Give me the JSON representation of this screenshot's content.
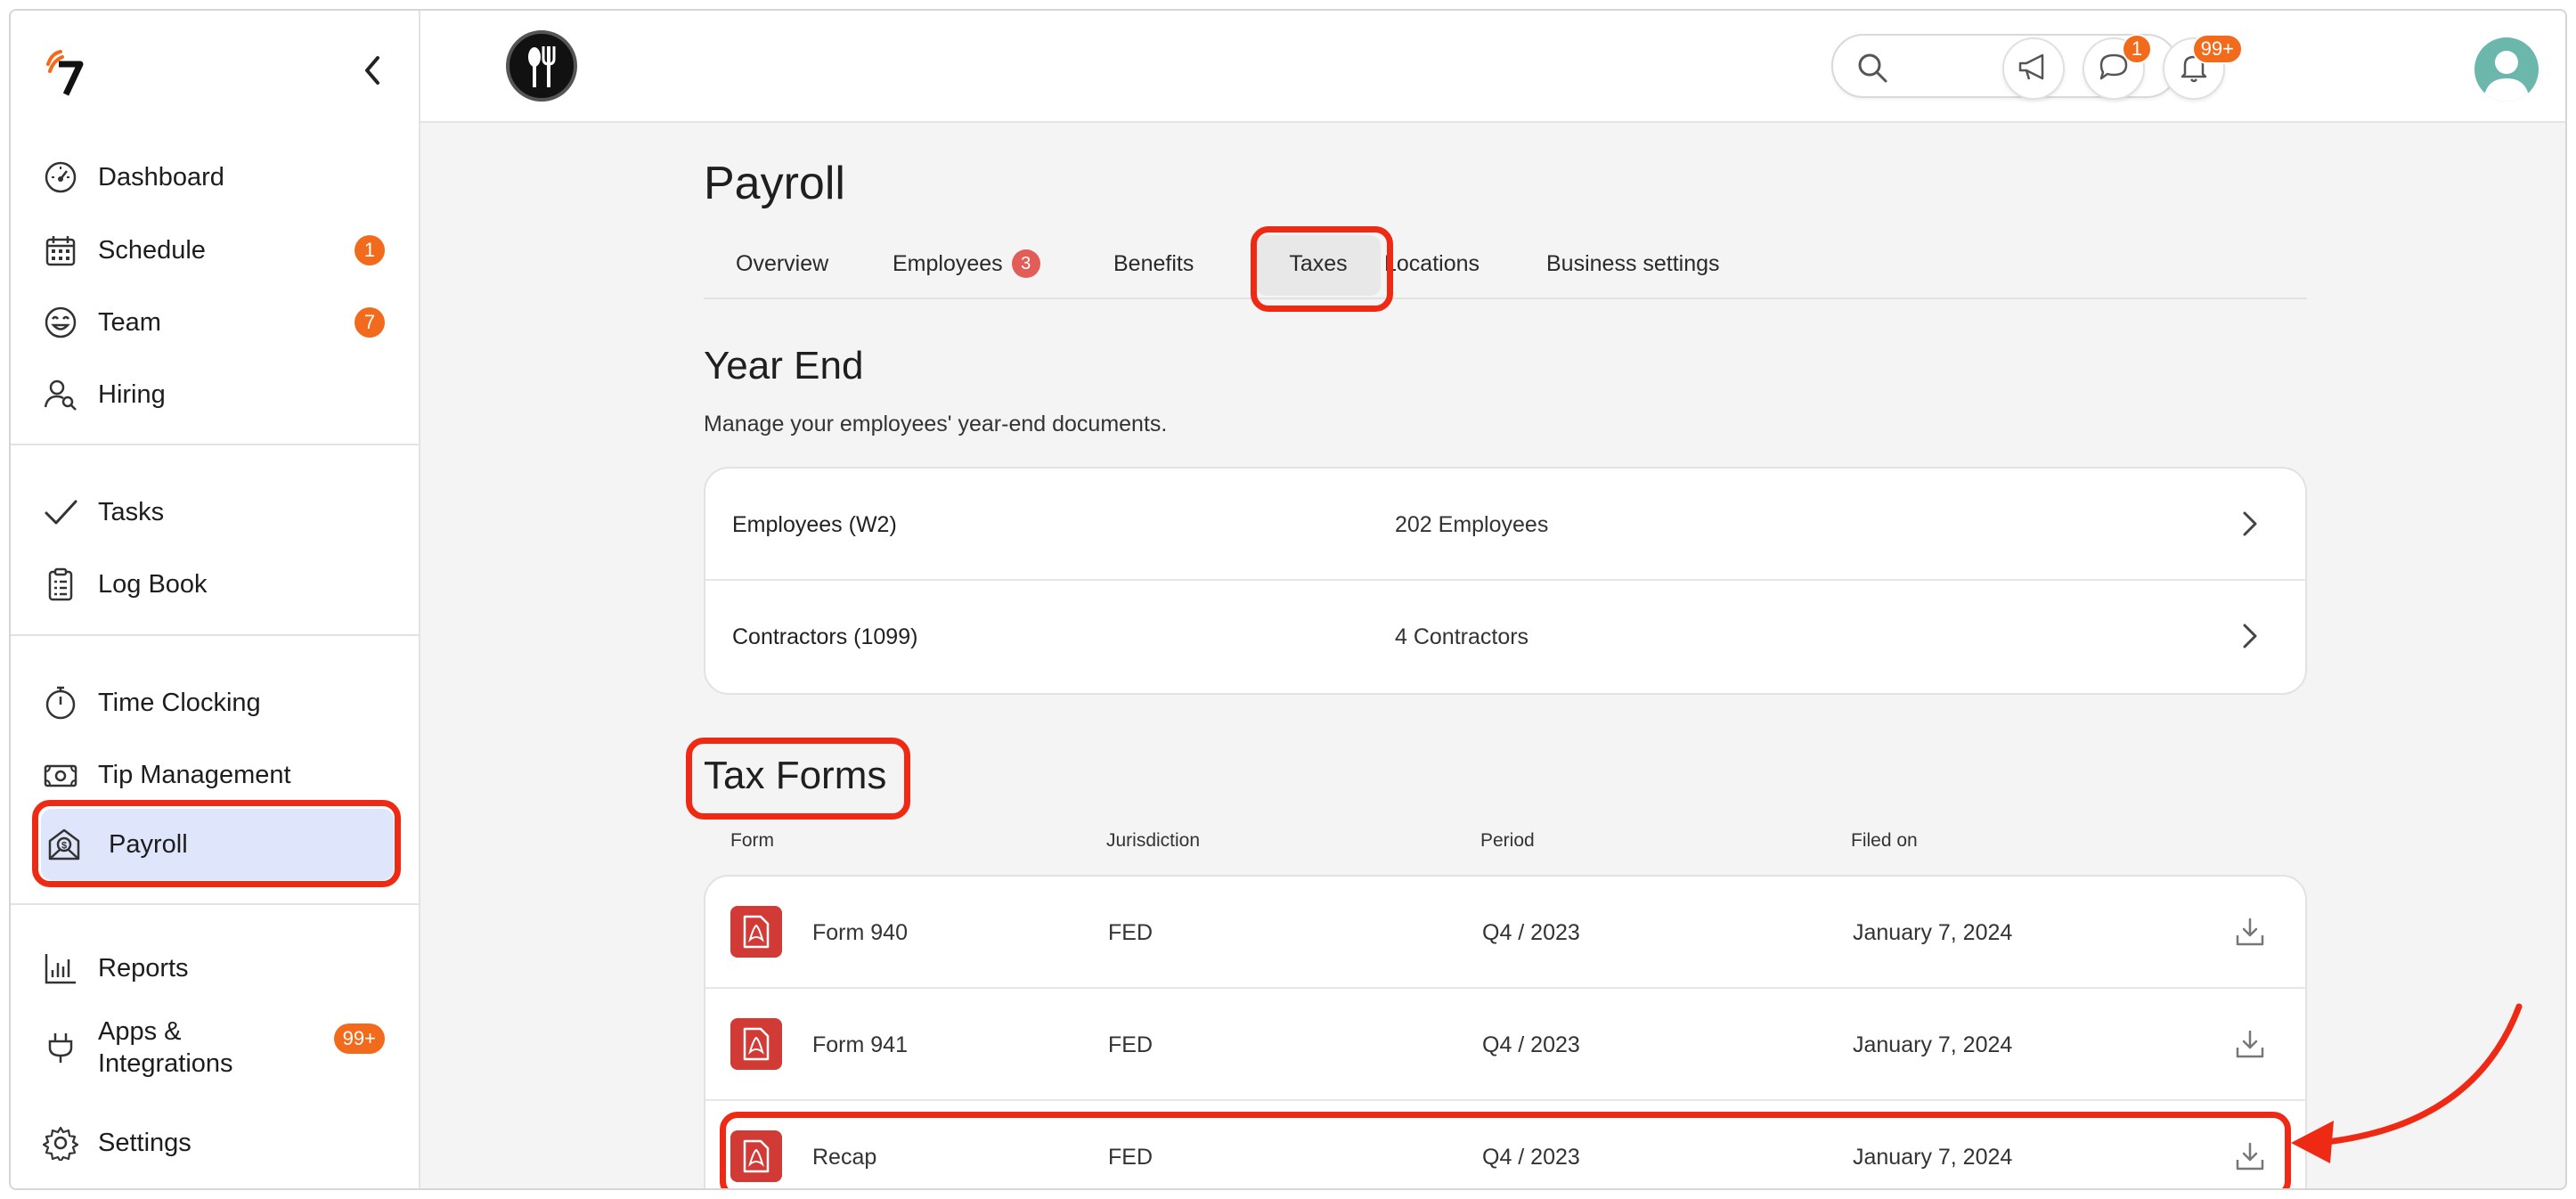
{
  "sidebar": {
    "items": [
      {
        "label": "Dashboard"
      },
      {
        "label": "Schedule",
        "badge": "1"
      },
      {
        "label": "Team",
        "badge": "7"
      },
      {
        "label": "Hiring"
      },
      {
        "label": "Tasks"
      },
      {
        "label": "Log Book"
      },
      {
        "label": "Time Clocking"
      },
      {
        "label": "Tip Management"
      },
      {
        "label": "Payroll"
      },
      {
        "label": "Reports"
      },
      {
        "label": "Apps & Integrations",
        "badge": "99+"
      },
      {
        "label": "Settings"
      }
    ]
  },
  "header": {
    "search_placeholder": "",
    "chat_badge": "1",
    "notifications_badge": "99+"
  },
  "page": {
    "title": "Payroll",
    "tabs": [
      {
        "label": "Overview"
      },
      {
        "label": "Employees",
        "badge": "3"
      },
      {
        "label": "Benefits"
      },
      {
        "label": "Taxes",
        "active": true
      },
      {
        "label": "Locations"
      },
      {
        "label": "Business settings"
      }
    ]
  },
  "year_end": {
    "title": "Year End",
    "description": "Manage your employees' year-end documents.",
    "rows": [
      {
        "label": "Employees (W2)",
        "count": "202 Employees"
      },
      {
        "label": "Contractors (1099)",
        "count": "4 Contractors"
      }
    ]
  },
  "tax_forms": {
    "title": "Tax Forms",
    "headers": {
      "form": "Form",
      "jurisdiction": "Jurisdiction",
      "period": "Period",
      "filed_on": "Filed on"
    },
    "rows": [
      {
        "form": "Form 940",
        "jurisdiction": "FED",
        "period": "Q4 / 2023",
        "filed_on": "January 7, 2024"
      },
      {
        "form": "Form 941",
        "jurisdiction": "FED",
        "period": "Q4 / 2023",
        "filed_on": "January 7, 2024"
      },
      {
        "form": "Recap",
        "jurisdiction": "FED",
        "period": "Q4 / 2023",
        "filed_on": "January 7, 2024"
      }
    ]
  },
  "colors": {
    "accent": "#f26b1d",
    "highlight": "#ee2a14",
    "active_nav": "#dfe5fb",
    "pdf_red": "#d23a36"
  }
}
